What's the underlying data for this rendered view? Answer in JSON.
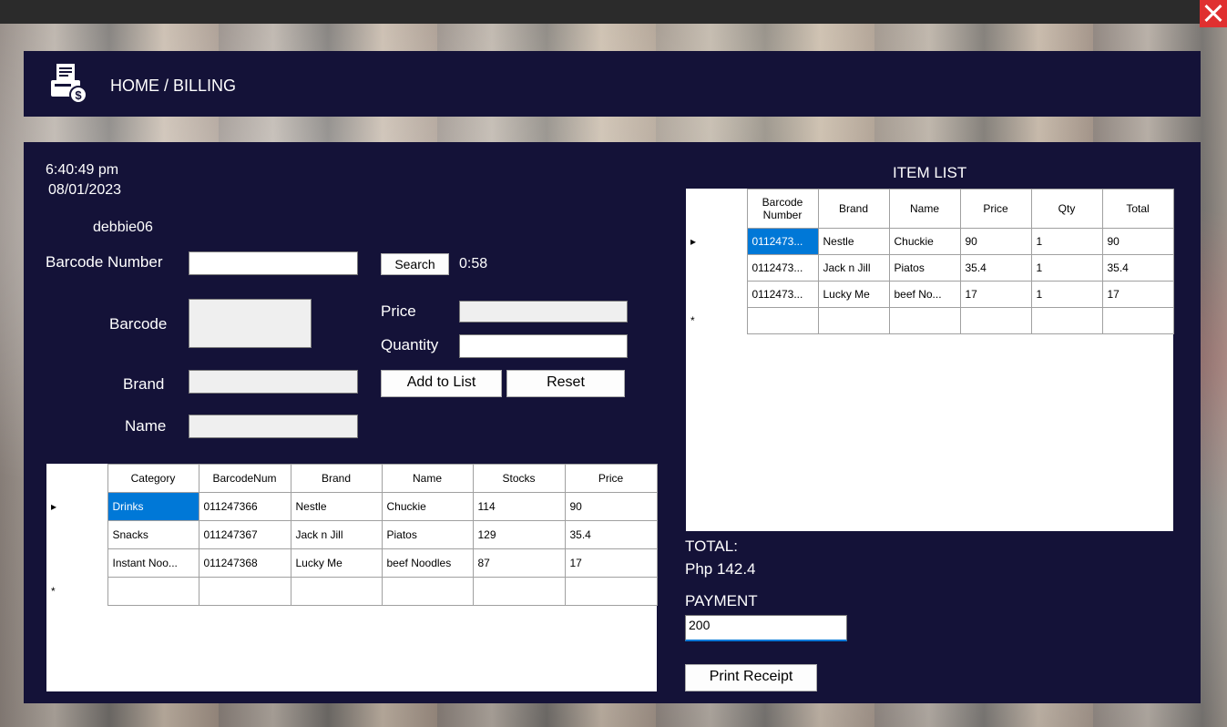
{
  "window": {
    "close_icon": "close-icon"
  },
  "header": {
    "breadcrumb": "HOME  / BILLING",
    "icon": "billing-icon"
  },
  "info": {
    "time": "6:40:49 pm",
    "date": "08/01/2023",
    "user": "debbie06"
  },
  "search": {
    "label": "Barcode Number",
    "value": "",
    "button": "Search",
    "timer": "0:58"
  },
  "form": {
    "barcode_label": "Barcode",
    "brand_label": "Brand",
    "name_label": "Name",
    "price_label": "Price",
    "quantity_label": "Quantity",
    "add_button": "Add to List",
    "reset_button": "Reset"
  },
  "product_grid": {
    "columns": [
      "Category",
      "BarcodeNum",
      "Brand",
      "Name",
      "Stocks",
      "Price"
    ],
    "rows": [
      [
        "Drinks",
        "011247366",
        "Nestle",
        "Chuckie",
        "114",
        "90"
      ],
      [
        "Snacks",
        "011247367",
        "Jack n Jill",
        "Piatos",
        "129",
        "35.4"
      ],
      [
        "Instant Noo...",
        "011247368",
        "Lucky Me",
        "beef Noodles",
        "87",
        "17"
      ]
    ],
    "new_row_marker": "*"
  },
  "item_list": {
    "title": "ITEM LIST",
    "columns": [
      "Barcode Number",
      "Brand",
      "Name",
      "Price",
      "Qty",
      "Total"
    ],
    "rows": [
      [
        "0112473...",
        "Nestle",
        "Chuckie",
        "90",
        "1",
        "90"
      ],
      [
        "0112473...",
        "Jack n Jill",
        "Piatos",
        "35.4",
        "1",
        "35.4"
      ],
      [
        "0112473...",
        "Lucky Me",
        "beef No...",
        "17",
        "1",
        "17"
      ]
    ],
    "new_row_marker": "*"
  },
  "totals": {
    "total_label": "TOTAL:",
    "total_value": "Php 142.4",
    "payment_label": "PAYMENT",
    "payment_value": "200",
    "print_button": "Print Receipt"
  }
}
